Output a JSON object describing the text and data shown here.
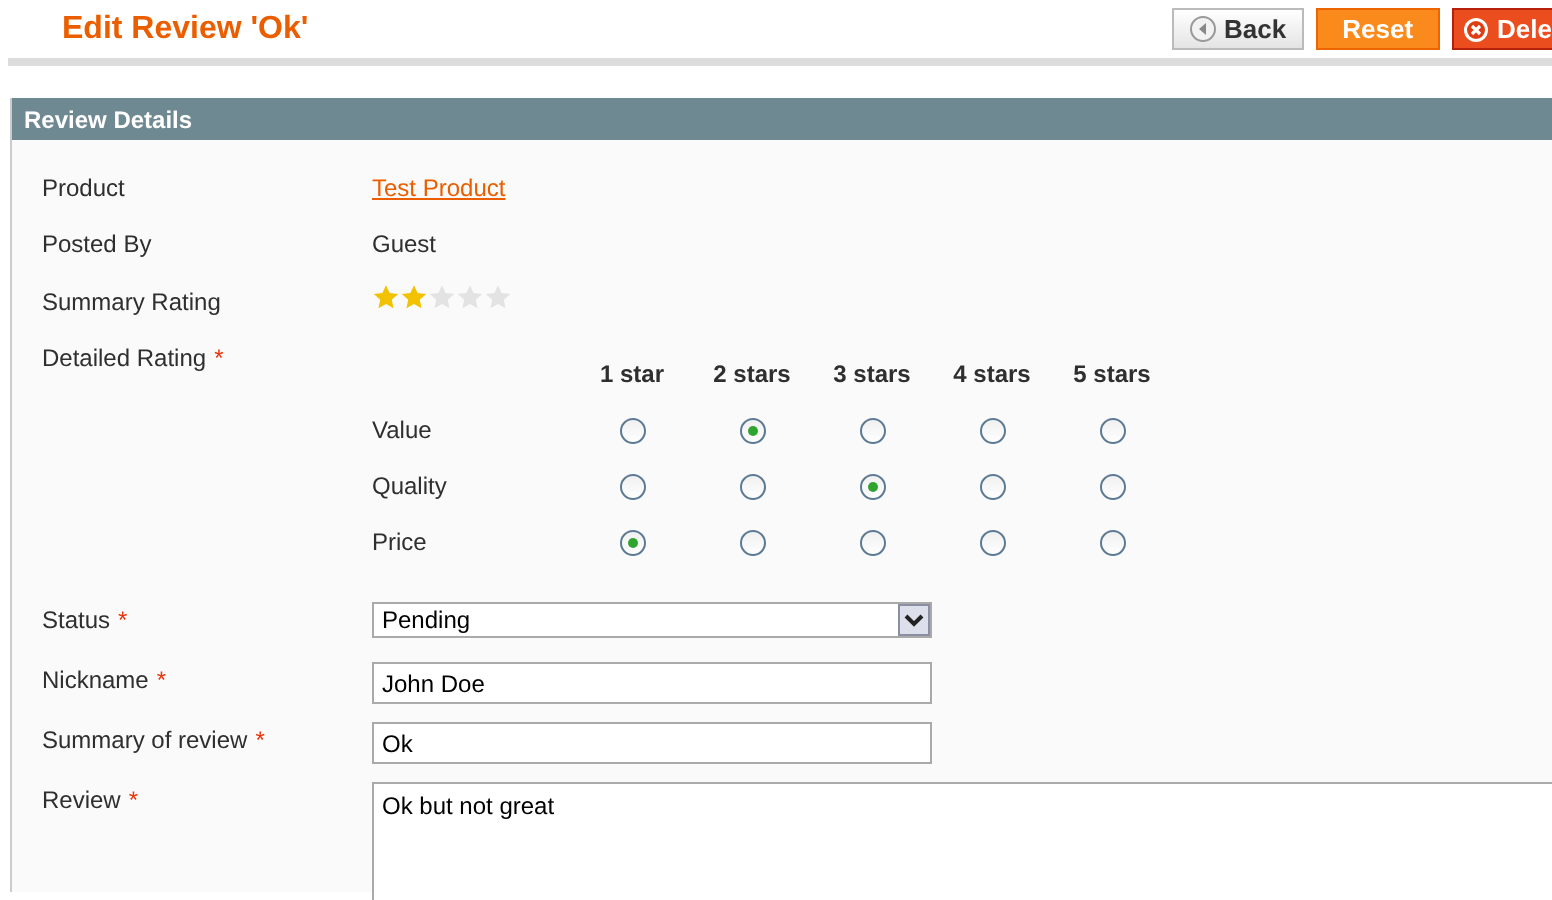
{
  "page_title": "Edit Review 'Ok'",
  "buttons": [
    {
      "label": "Back",
      "kind": "back"
    },
    {
      "label": "Reset",
      "kind": "reset"
    },
    {
      "label": "Dele",
      "kind": "delete"
    }
  ],
  "section_title": "Review Details",
  "product": {
    "label": "Product",
    "value": "Test Product"
  },
  "posted_by": {
    "label": "Posted By",
    "value": "Guest"
  },
  "summary_rating": {
    "label": "Summary Rating",
    "stars": 2
  },
  "detailed_rating": {
    "label": "Detailed Rating",
    "mark": "*",
    "columns": [
      "1 star",
      "2 stars",
      "3 stars",
      "4 stars",
      "5 stars"
    ],
    "rows": [
      {
        "label": "Value",
        "options": [
          {
            "selected": false
          },
          {
            "selected": true
          },
          {
            "selected": false
          },
          {
            "selected": false
          },
          {
            "selected": false
          }
        ]
      },
      {
        "label": "Quality",
        "options": [
          {
            "selected": false
          },
          {
            "selected": false
          },
          {
            "selected": true
          },
          {
            "selected": false
          },
          {
            "selected": false
          }
        ]
      },
      {
        "label": "Price",
        "options": [
          {
            "selected": true
          },
          {
            "selected": false
          },
          {
            "selected": false
          },
          {
            "selected": false
          },
          {
            "selected": false
          }
        ]
      }
    ]
  },
  "fields": [
    {
      "label": "Status",
      "mark": "*",
      "kind": "select",
      "value": "Pending"
    },
    {
      "label": "Nickname",
      "mark": "*",
      "kind": "text",
      "value": "John Doe"
    },
    {
      "label": "Summary of review",
      "mark": "*",
      "kind": "text",
      "value": "Ok"
    },
    {
      "label": "Review",
      "mark": "*",
      "kind": "textarea",
      "value": "Ok but not great"
    }
  ]
}
